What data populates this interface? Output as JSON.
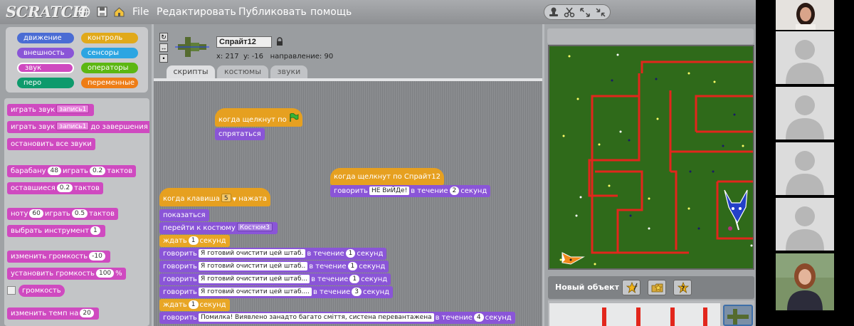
{
  "app": {
    "logo": "SCRATCH",
    "menu": [
      "File",
      "Редактировать",
      "Публиковать",
      "помощь"
    ]
  },
  "categories": [
    {
      "label": "движение",
      "color": "#4a6cd4"
    },
    {
      "label": "контроль",
      "color": "#e1a91a"
    },
    {
      "label": "внешность",
      "color": "#8a55d7"
    },
    {
      "label": "сенсоры",
      "color": "#2ca5e2"
    },
    {
      "label": "звук",
      "color": "#cf4ac0"
    },
    {
      "label": "операторы",
      "color": "#5cb712"
    },
    {
      "label": "перо",
      "color": "#0e9a6c"
    },
    {
      "label": "переменные",
      "color": "#ee7d16"
    }
  ],
  "palette": {
    "play_sound": "играть звук",
    "play_sound_value": "запись1",
    "play_until": "играть звук",
    "play_until_value": "запись1",
    "play_until_suffix": "до завершения",
    "stop_all": "остановить все звуки",
    "drum": "барабану",
    "drum_value": "48",
    "drum_play": "играть",
    "drum_beats": "0.2",
    "drum_suffix": "тактов",
    "rest": "оставшиеся",
    "rest_value": "0.2",
    "rest_suffix": "тактов",
    "note": "ноту",
    "note_value": "60",
    "note_play": "играть",
    "note_beats": "0.5",
    "note_suffix": "тактов",
    "instrument": "выбрать инструмент",
    "instrument_value": "1",
    "change_volume": "изменить громкость",
    "change_volume_value": "-10",
    "set_volume": "установить громкость",
    "set_volume_value": "100",
    "set_volume_suffix": "%",
    "volume": "громкость",
    "change_tempo": "изменить темп на",
    "change_tempo_value": "20"
  },
  "sprite": {
    "name": "Спрайт12",
    "x_label": "x:",
    "x": "217",
    "y_label": "y:",
    "y": "-16",
    "dir_label": "направление:",
    "dir": "90"
  },
  "tabs": [
    "скрипты",
    "костюмы",
    "звуки"
  ],
  "scripts": {
    "s1_hat": "когда щелкнут по",
    "s1_hide": "спрятаться",
    "s2_hat": "когда щелкнут по Спрайт12",
    "s2_say": "говорить",
    "s2_text": "НЕ ВиЙДе!",
    "s2_for": "в течение",
    "s2_secs": "2",
    "s2_unit": "секунд",
    "s3_hat": "когда клавиша",
    "s3_key": "5",
    "s3_pressed": "нажата",
    "show": "показаться",
    "switch_costume": "перейти к костюму",
    "costume": "Костюм3",
    "wait": "ждать",
    "wait_value": "1",
    "wait_unit": "секунд",
    "say": "говорить",
    "for": "в течение",
    "unit": "секунд",
    "say1": "Я готовий очистити  цей штаб.",
    "say1_secs": "1",
    "say2": "Я готовий очистити  цей штаб..",
    "say2_secs": "1",
    "say3": "Я готовий очистити  цей штаб...",
    "say3_secs": "1",
    "say4": "Я готовий очистити цей штаб....",
    "say4_secs": "3",
    "wait2_value": "1",
    "say5": "Помилка! Виявлено занадто багато сміття, систена перевантажена",
    "say5_secs": "4"
  },
  "stage": {
    "new_object": "Новый объект"
  }
}
